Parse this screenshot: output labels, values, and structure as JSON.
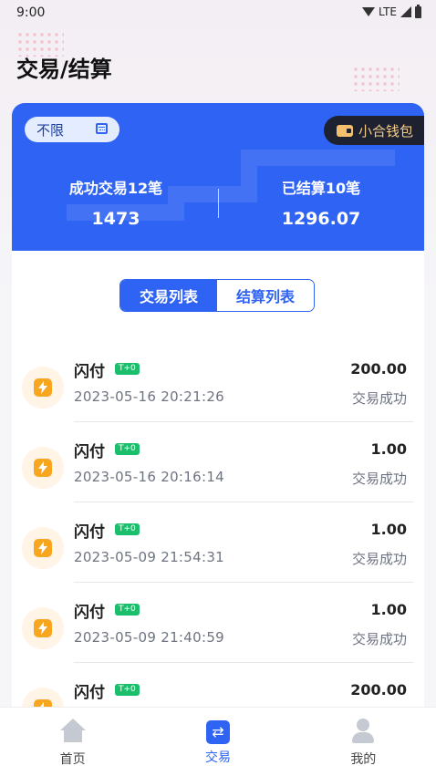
{
  "status_bar": {
    "time": "9:00",
    "network": "LTE"
  },
  "page": {
    "title": "交易/结算"
  },
  "summary_card": {
    "filter_label": "不限",
    "wallet_label": "小合钱包",
    "success_label": "成功交易12笔",
    "success_value": "1473",
    "settled_label": "已结算10笔",
    "settled_value": "1296.07"
  },
  "tabs": {
    "transactions": "交易列表",
    "settlements": "结算列表"
  },
  "transactions": [
    {
      "name": "闪付",
      "badge": "T+0",
      "amount": "200.00",
      "time": "2023-05-16 20:21:26",
      "status": "交易成功"
    },
    {
      "name": "闪付",
      "badge": "T+0",
      "amount": "1.00",
      "time": "2023-05-16 20:16:14",
      "status": "交易成功"
    },
    {
      "name": "闪付",
      "badge": "T+0",
      "amount": "1.00",
      "time": "2023-05-09 21:54:31",
      "status": "交易成功"
    },
    {
      "name": "闪付",
      "badge": "T+0",
      "amount": "1.00",
      "time": "2023-05-09 21:40:59",
      "status": "交易成功"
    },
    {
      "name": "闪付",
      "badge": "T+0",
      "amount": "200.00",
      "time": "",
      "status": ""
    }
  ],
  "bottom_nav": {
    "home": "首页",
    "trade": "交易",
    "mine": "我的"
  },
  "colors": {
    "primary": "#2f63f4",
    "badge": "#1bbf6b",
    "flash": "#f8a51f",
    "wallet_text": "#f2cd8c"
  }
}
